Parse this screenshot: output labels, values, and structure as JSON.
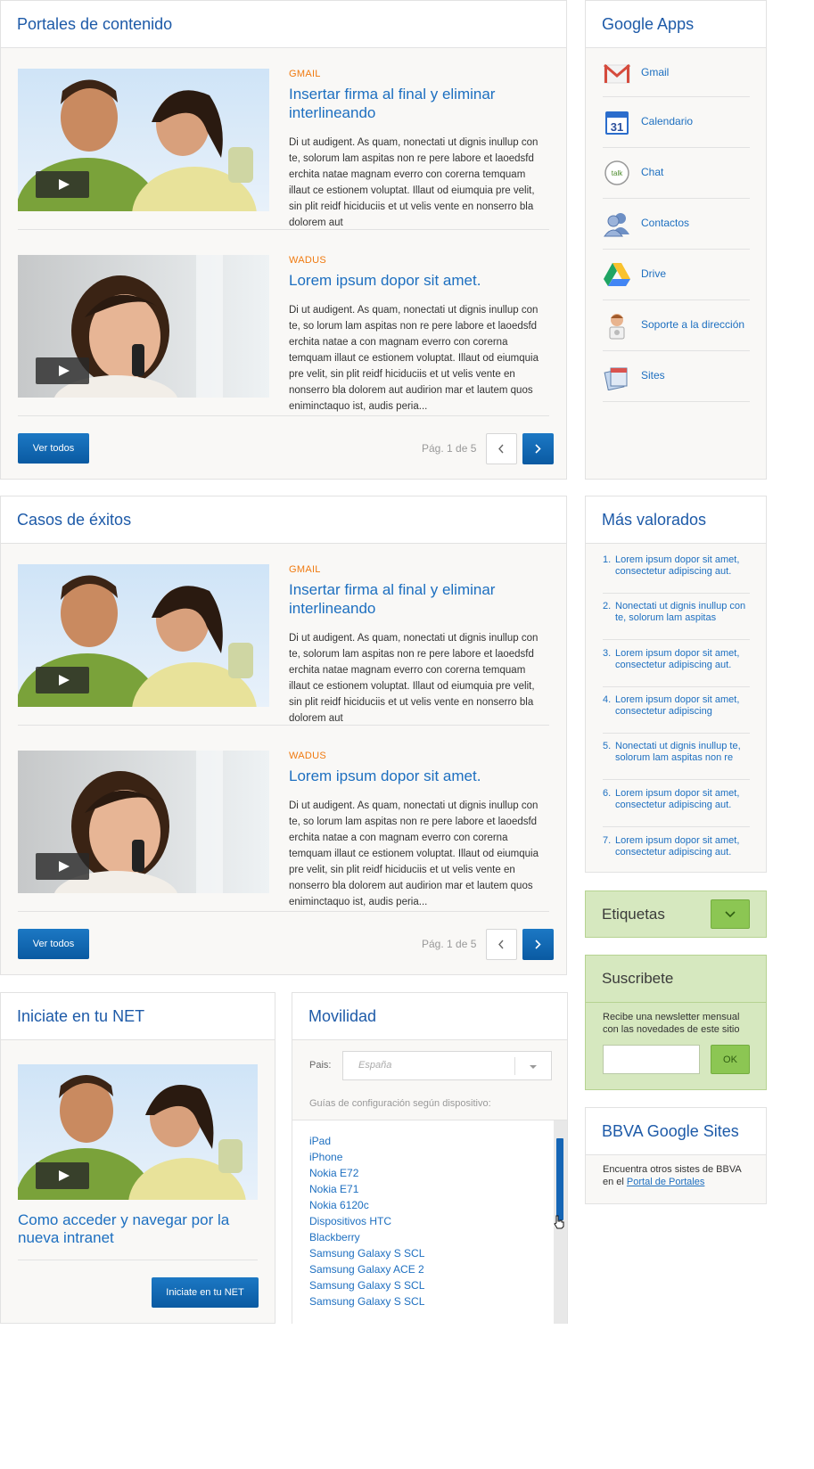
{
  "portales": {
    "title": "Portales de contenido",
    "articles": [
      {
        "tag": "GMAIL",
        "title": "Insertar firma al final y eliminar interlineando",
        "body": "Di ut audigent. As quam, nonectati ut dignis inullup con te, solorum lam aspitas non re pere labore et laoedsfd erchita natae magnam everro con corerna temquam illaut ce estionem voluptat. Illaut od eiumquia pre velit, sin plit reidf hiciduciis et ut velis vente en nonserro bla dolorem aut"
      },
      {
        "tag": "WADUS",
        "title": "Lorem ipsum dopor sit amet.",
        "body": "Di ut audigent. As quam, nonectati ut dignis inullup con te, so lorum lam aspitas non re pere labore et laoedsfd erchita natae a con magnam everro con corerna temquam illaut ce estionem voluptat. Illaut od eiumquia pre velit, sin plit reidf hiciduciis et ut velis vente en nonserro bla dolorem aut audirion mar et lautem quos eniminctaquo ist, audis peria..."
      }
    ],
    "button": "Ver todos",
    "pager": "Pág. 1 de 5"
  },
  "casos": {
    "title": "Casos de éxitos",
    "articles": [
      {
        "tag": "GMAIL",
        "title": "Insertar firma al final y eliminar interlineando",
        "body": "Di ut audigent. As quam, nonectati ut dignis inullup con te, solorum lam aspitas non re pere labore et laoedsfd erchita natae magnam everro con corerna temquam illaut ce estionem voluptat. Illaut od eiumquia pre velit, sin plit reidf hiciduciis et ut velis vente en nonserro bla dolorem aut"
      },
      {
        "tag": "WADUS",
        "title": "Lorem ipsum dopor sit amet.",
        "body": "Di ut audigent. As quam, nonectati ut dignis inullup con te, so lorum lam aspitas non re pere labore et laoedsfd erchita natae a con magnam everro con corerna temquam illaut ce estionem voluptat. Illaut od eiumquia pre velit, sin plit reidf hiciduciis et ut velis vente en nonserro bla dolorem aut audirion mar et lautem quos eniminctaquo ist, audis peria..."
      }
    ],
    "button": "Ver todos",
    "pager": "Pág. 1 de 5"
  },
  "google_apps": {
    "title": "Google Apps",
    "items": [
      {
        "label": "Gmail",
        "icon": "gmail-icon"
      },
      {
        "label": "Calendario",
        "icon": "calendar-icon",
        "icon_text": "31"
      },
      {
        "label": "Chat",
        "icon": "chat-icon",
        "icon_text": "talk"
      },
      {
        "label": "Contactos",
        "icon": "contacts-icon"
      },
      {
        "label": "Drive",
        "icon": "drive-icon"
      },
      {
        "label": "Soporte a la dirección",
        "icon": "support-icon"
      },
      {
        "label": "Sites",
        "icon": "sites-icon"
      }
    ]
  },
  "mas_valorados": {
    "title": "Más valorados",
    "items": [
      {
        "num": "1.",
        "text": "Lorem ipsum dopor sit amet, consectetur adipiscing aut."
      },
      {
        "num": "2.",
        "text": "Nonectati ut dignis inullup con te, solorum lam aspitas"
      },
      {
        "num": "3.",
        "text": "Lorem ipsum dopor sit amet, consectetur adipiscing aut."
      },
      {
        "num": "4.",
        "text": "Lorem ipsum dopor sit amet, consectetur adipiscing"
      },
      {
        "num": "5.",
        "text": "Nonectati ut dignis inullup te, solorum lam aspitas non re"
      },
      {
        "num": "6.",
        "text": "Lorem ipsum dopor sit amet, consectetur adipiscing aut."
      },
      {
        "num": "7.",
        "text": "Lorem ipsum dopor sit amet, consectetur adipiscing aut."
      }
    ]
  },
  "etiquetas": {
    "title": "Etiquetas"
  },
  "suscribete": {
    "title": "Suscribete",
    "text": "Recibe una newsletter mensual con las novedades de este sitio",
    "button": "OK"
  },
  "bbva_sites": {
    "title": "BBVA Google Sites",
    "text_before": "Encuentra otros sistes de BBVA en el ",
    "link": "Portal de Portales"
  },
  "iniciate": {
    "title": "Iniciate en tu NET",
    "caption": "Como acceder y navegar por la nueva intranet",
    "button": "Iniciate en tu NET"
  },
  "movilidad": {
    "title": "Movilidad",
    "pais_label": "Pais:",
    "pais_value": "España",
    "guides_label": "Guías de configuración según dispositivo:",
    "devices": [
      "iPad",
      "iPhone",
      "Nokia E72",
      "Nokia E71",
      "Nokia 6120c",
      "Dispositivos HTC",
      "Blackberry",
      "Samsung Galaxy S SCL",
      "Samsung Galaxy ACE 2",
      "Samsung Galaxy S SCL",
      "Samsung Galaxy S SCL"
    ]
  },
  "colors": {
    "accent": "#1d6fc0",
    "button": "#0a5aa2",
    "tag": "#f07a10",
    "green": "#d6e8bf"
  }
}
